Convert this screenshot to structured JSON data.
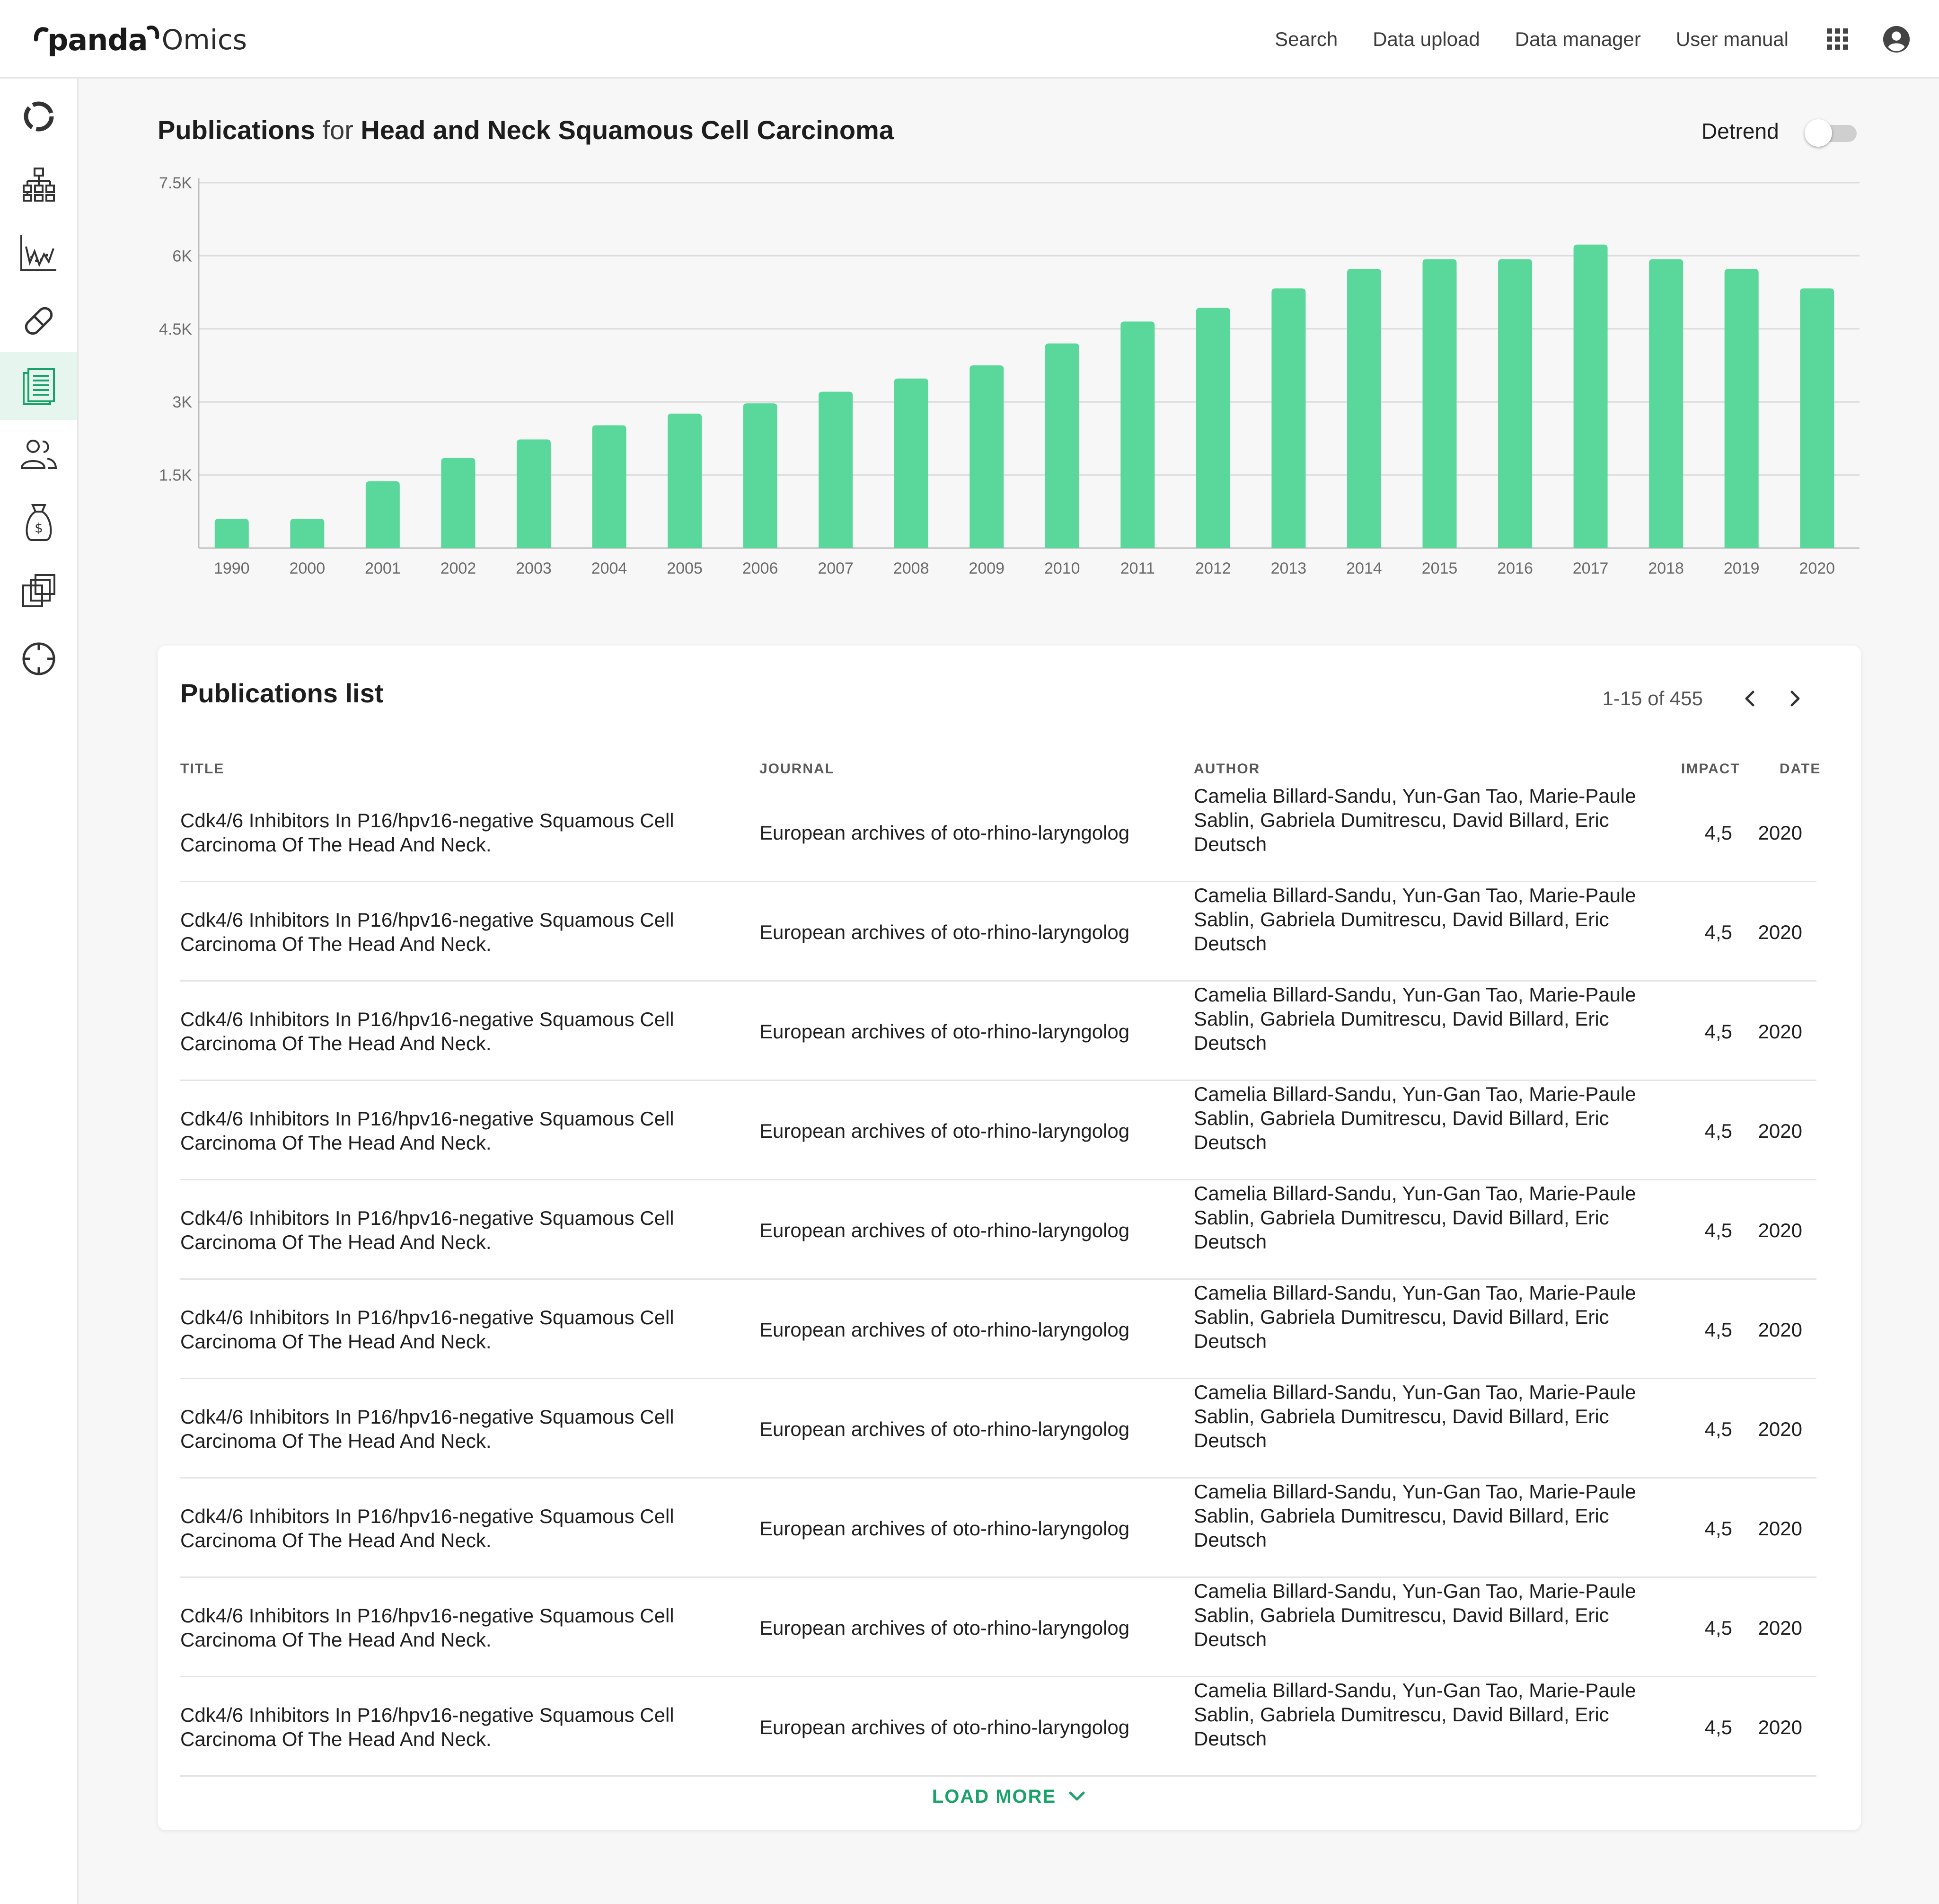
{
  "brand": {
    "logo_main": "panda",
    "logo_suffix": "Omics"
  },
  "nav": {
    "links": [
      "Search",
      "Data upload",
      "Data manager",
      "User manual"
    ],
    "apps_icon": "apps-grid-icon",
    "account_icon": "account-circle-icon"
  },
  "sidebar": {
    "items": [
      {
        "icon": "ring-chart-icon"
      },
      {
        "icon": "hierarchy-icon"
      },
      {
        "icon": "scatter-chart-icon"
      },
      {
        "icon": "pill-icon"
      },
      {
        "icon": "document-list-icon",
        "active": true
      },
      {
        "icon": "people-icon"
      },
      {
        "icon": "money-bag-icon"
      },
      {
        "icon": "layers-icon"
      },
      {
        "icon": "target-icon"
      }
    ],
    "active_color": "#1aa26b"
  },
  "chart_header": {
    "title_bold": "Publications",
    "title_mid": "for",
    "title_disease": "Head and Neck Squamous Cell Carcinoma",
    "detrend_label": "Detrend",
    "detrend_on": false
  },
  "chart_data": {
    "type": "bar",
    "title": "Publications for Head and Neck Squamous Cell Carcinoma",
    "xlabel": "",
    "ylabel": "",
    "categories": [
      "1990",
      "2000",
      "2001",
      "2002",
      "2003",
      "2004",
      "2005",
      "2006",
      "2007",
      "2008",
      "2009",
      "2010",
      "2011",
      "2012",
      "2013",
      "2014",
      "2015",
      "2016",
      "2017",
      "2018",
      "2019",
      "2020"
    ],
    "values": [
      600,
      600,
      1370,
      1850,
      2230,
      2520,
      2760,
      2970,
      3210,
      3480,
      3750,
      4200,
      4650,
      4930,
      5330,
      5730,
      5930,
      5930,
      6230,
      5930,
      5730,
      5330
    ],
    "yticks": [
      1500,
      3000,
      4500,
      6000,
      7500
    ],
    "ytick_labels": [
      "1.5K",
      "3K",
      "4.5K",
      "6K",
      "7.5K"
    ],
    "ylim": [
      0,
      7500
    ],
    "grid": true,
    "bar_color": "#5ad79b"
  },
  "publications": {
    "title": "Publications list",
    "pagination": "1-15 of 455",
    "columns": [
      "TITLE",
      "JOURNAL",
      "AUTHOR",
      "IMPACT",
      "DATE"
    ],
    "rows": [
      {
        "title": "Cdk4/6 Inhibitors In P16/hpv16-negative Squamous Cell Carcinoma Of The Head And Neck.",
        "journal": "European archives of oto-rhino-laryngolog",
        "author": "Camelia Billard-Sandu, Yun-Gan Tao, Marie-Paule Sablin, Gabriela Dumitrescu, David Billard, Eric Deutsch",
        "impact": "4,5",
        "date": "2020"
      },
      {
        "title": "Cdk4/6 Inhibitors In P16/hpv16-negative Squamous Cell Carcinoma Of The Head And Neck.",
        "journal": "European archives of oto-rhino-laryngolog",
        "author": "Camelia Billard-Sandu, Yun-Gan Tao, Marie-Paule Sablin, Gabriela Dumitrescu, David Billard, Eric Deutsch",
        "impact": "4,5",
        "date": "2020"
      },
      {
        "title": "Cdk4/6 Inhibitors In P16/hpv16-negative Squamous Cell Carcinoma Of The Head And Neck.",
        "journal": "European archives of oto-rhino-laryngolog",
        "author": "Camelia Billard-Sandu, Yun-Gan Tao, Marie-Paule Sablin, Gabriela Dumitrescu, David Billard, Eric Deutsch",
        "impact": "4,5",
        "date": "2020"
      },
      {
        "title": "Cdk4/6 Inhibitors In P16/hpv16-negative Squamous Cell Carcinoma Of The Head And Neck.",
        "journal": "European archives of oto-rhino-laryngolog",
        "author": "Camelia Billard-Sandu, Yun-Gan Tao, Marie-Paule Sablin, Gabriela Dumitrescu, David Billard, Eric Deutsch",
        "impact": "4,5",
        "date": "2020"
      },
      {
        "title": "Cdk4/6 Inhibitors In P16/hpv16-negative Squamous Cell Carcinoma Of The Head And Neck.",
        "journal": "European archives of oto-rhino-laryngolog",
        "author": "Camelia Billard-Sandu, Yun-Gan Tao, Marie-Paule Sablin, Gabriela Dumitrescu, David Billard, Eric Deutsch",
        "impact": "4,5",
        "date": "2020"
      },
      {
        "title": "Cdk4/6 Inhibitors In P16/hpv16-negative Squamous Cell Carcinoma Of The Head And Neck.",
        "journal": "European archives of oto-rhino-laryngolog",
        "author": "Camelia Billard-Sandu, Yun-Gan Tao, Marie-Paule Sablin, Gabriela Dumitrescu, David Billard, Eric Deutsch",
        "impact": "4,5",
        "date": "2020"
      },
      {
        "title": "Cdk4/6 Inhibitors In P16/hpv16-negative Squamous Cell Carcinoma Of The Head And Neck.",
        "journal": "European archives of oto-rhino-laryngolog",
        "author": "Camelia Billard-Sandu, Yun-Gan Tao, Marie-Paule Sablin, Gabriela Dumitrescu, David Billard, Eric Deutsch",
        "impact": "4,5",
        "date": "2020"
      },
      {
        "title": "Cdk4/6 Inhibitors In P16/hpv16-negative Squamous Cell Carcinoma Of The Head And Neck.",
        "journal": "European archives of oto-rhino-laryngolog",
        "author": "Camelia Billard-Sandu, Yun-Gan Tao, Marie-Paule Sablin, Gabriela Dumitrescu, David Billard, Eric Deutsch",
        "impact": "4,5",
        "date": "2020"
      },
      {
        "title": "Cdk4/6 Inhibitors In P16/hpv16-negative Squamous Cell Carcinoma Of The Head And Neck.",
        "journal": "European archives of oto-rhino-laryngolog",
        "author": "Camelia Billard-Sandu, Yun-Gan Tao, Marie-Paule Sablin, Gabriela Dumitrescu, David Billard, Eric Deutsch",
        "impact": "4,5",
        "date": "2020"
      },
      {
        "title": "Cdk4/6 Inhibitors In P16/hpv16-negative Squamous Cell Carcinoma Of The Head And Neck.",
        "journal": "European archives of oto-rhino-laryngolog",
        "author": "Camelia Billard-Sandu, Yun-Gan Tao, Marie-Paule Sablin, Gabriela Dumitrescu, David Billard, Eric Deutsch",
        "impact": "4,5",
        "date": "2020"
      }
    ],
    "load_more_label": "LOAD MORE"
  }
}
